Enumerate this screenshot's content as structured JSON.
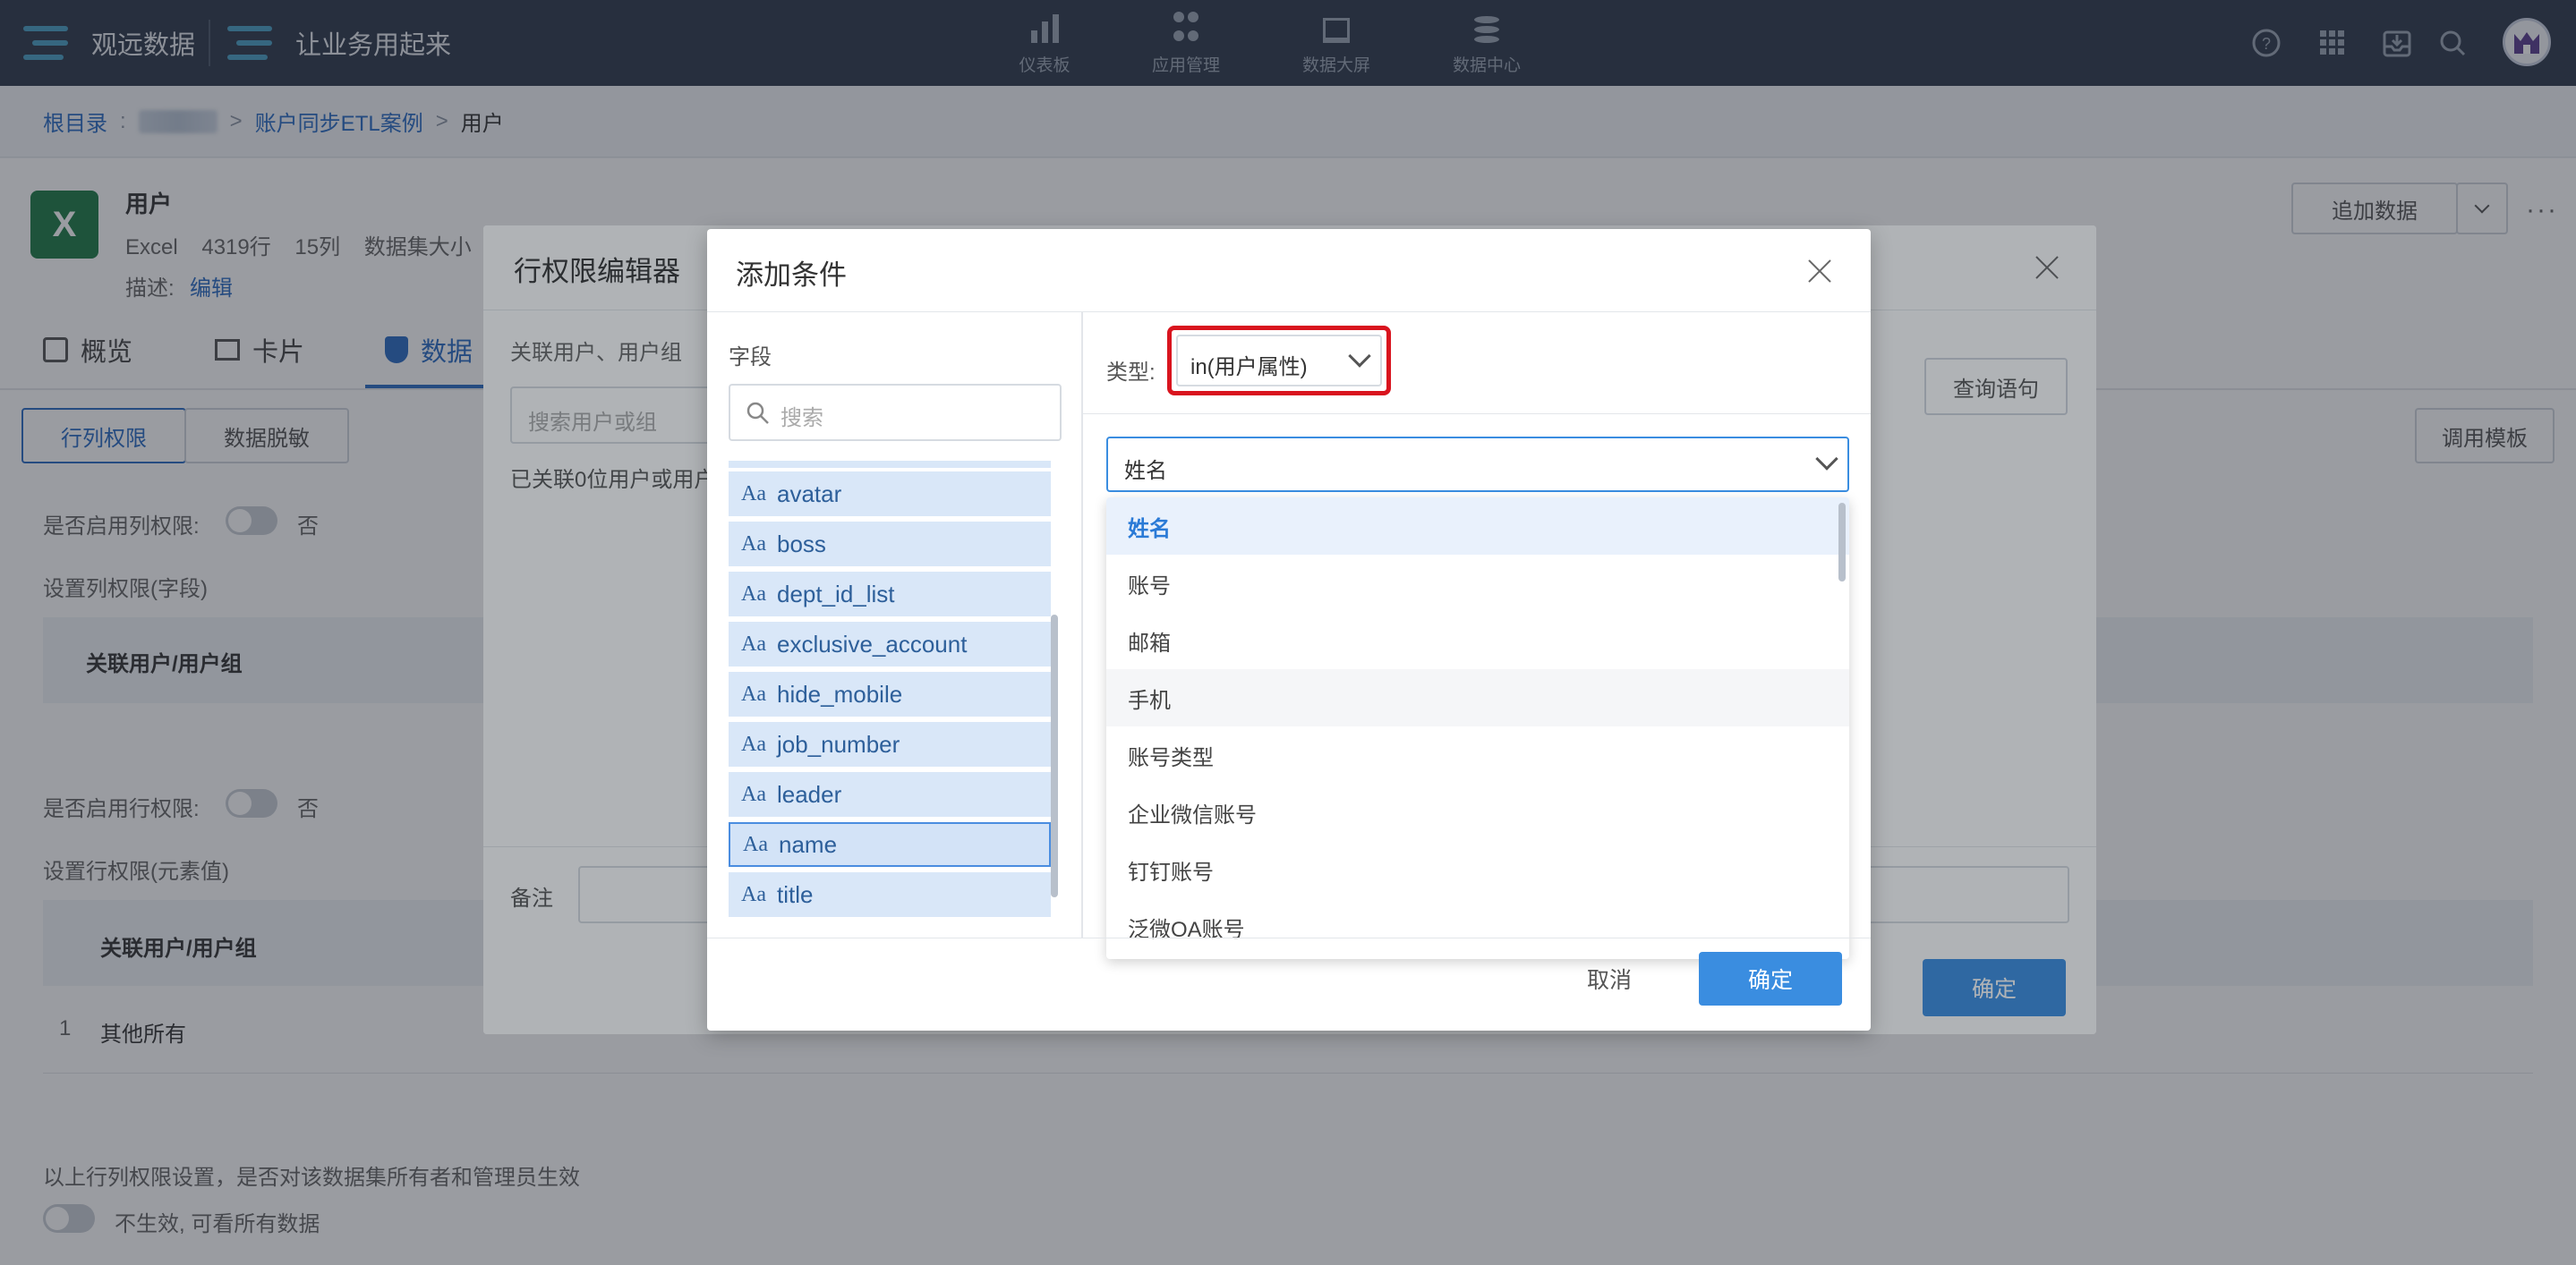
{
  "topbar": {
    "brand1": "观远数据",
    "brand2": "让业务用起来",
    "nav": [
      {
        "label": "仪表板",
        "icon": "bar-chart-icon"
      },
      {
        "label": "应用管理",
        "icon": "apps-grid-icon"
      },
      {
        "label": "数据大屏",
        "icon": "screen-chart-icon"
      },
      {
        "label": "数据中心",
        "icon": "database-icon"
      }
    ],
    "right_icons": [
      "help-icon",
      "app-launcher-icon",
      "inbox-icon",
      "search-icon"
    ]
  },
  "breadcrumb": {
    "root": "根目录",
    "sep1": ":",
    "sep2": ">",
    "folder": "账户同步ETL案例",
    "sep3": ">",
    "current": "用户"
  },
  "dataset": {
    "name": "用户",
    "meta": "Excel    4319行    15列    数据集大小",
    "desc_label": "描述:",
    "edit_label": "编辑",
    "append_label": "追加数据"
  },
  "tabs": [
    {
      "label": "概览"
    },
    {
      "label": "卡片"
    },
    {
      "label": "数据"
    }
  ],
  "subtabs": {
    "perm": "行列权限",
    "mask": "数据脱敏",
    "template": "调用模板"
  },
  "perm": {
    "col_enable_label": "是否启用列权限:",
    "col_enable_value": "否",
    "col_set_label": "设置列权限(字段)",
    "col_table_head": "关联用户/用户组",
    "row_enable_label": "是否启用行权限:",
    "row_enable_value": "否",
    "row_set_label": "设置行权限(元素值)",
    "row_table_head": "关联用户/用户组",
    "row1_index": "1",
    "row1_name": "其他所有",
    "footer_question": "以上行列权限设置，是否对该数据集所有者和管理员生效",
    "footer_toggle_text": "不生效, 可看所有数据"
  },
  "editor": {
    "title": "行权限编辑器",
    "assoc_label": "关联用户、用户组",
    "search_placeholder": "搜索用户或组",
    "assoc_info": "已关联0位用户或用户",
    "query_btn": "查询语句",
    "remark_label": "备注",
    "confirm_btn": "确定"
  },
  "condition": {
    "title": "添加条件",
    "field_label": "字段",
    "field_search_placeholder": "搜索",
    "fields": [
      "avatar",
      "boss",
      "dept_id_list",
      "exclusive_account",
      "hide_mobile",
      "job_number",
      "leader",
      "name",
      "title"
    ],
    "selected_field": "name",
    "type_label": "类型:",
    "type_value": "in(用户属性)",
    "attr_value": "姓名",
    "attr_options": [
      "姓名",
      "账号",
      "邮箱",
      "手机",
      "账号类型",
      "企业微信账号",
      "钉钉账号",
      "泛微OA账号"
    ],
    "cancel_btn": "取消",
    "confirm_btn": "确定",
    "highlight_color": "#d9141e",
    "accent_color": "#3a8de0"
  }
}
